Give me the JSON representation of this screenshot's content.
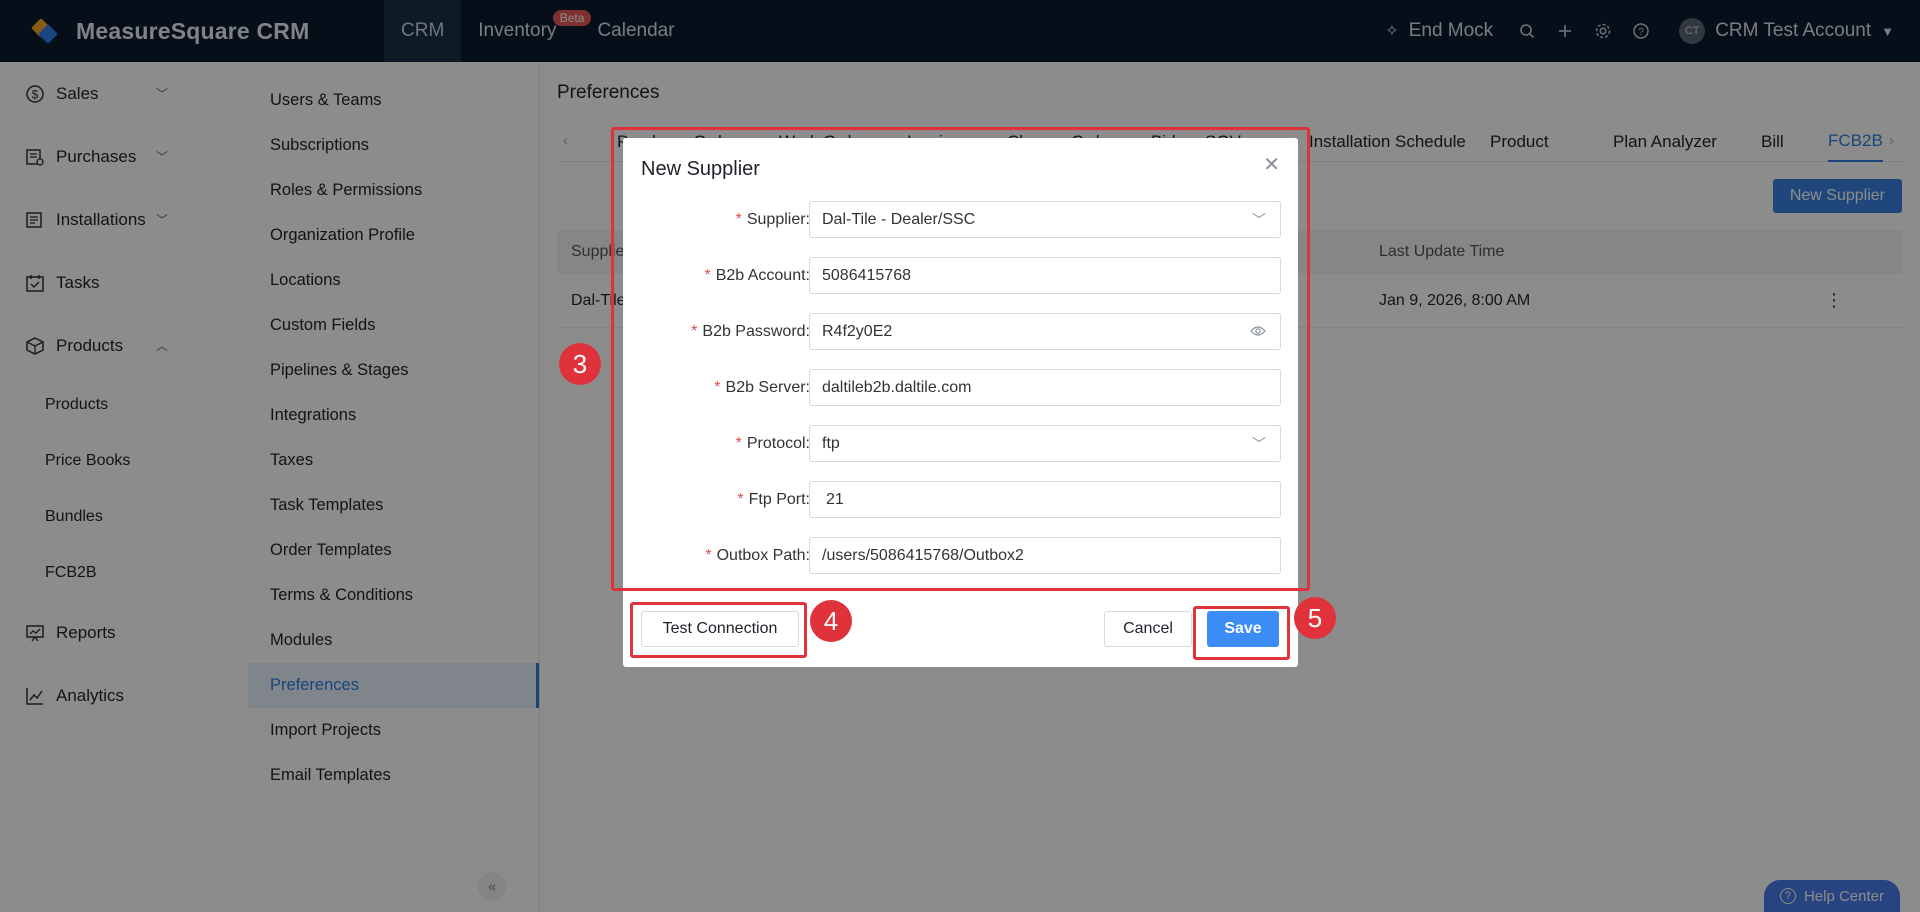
{
  "app": {
    "name": "MeasureSquare CRM"
  },
  "topnav": {
    "items": [
      {
        "label": "CRM"
      },
      {
        "label": "Inventory",
        "badge": "Beta"
      },
      {
        "label": "Calendar"
      }
    ],
    "end_mock": "End Mock",
    "account_initials": "CT",
    "account_name": "CRM Test Account"
  },
  "leftnav": {
    "items": [
      {
        "label": "Sales",
        "icon": "dollar-circle-icon"
      },
      {
        "label": "Purchases",
        "icon": "purchases-icon"
      },
      {
        "label": "Installations",
        "icon": "installations-icon"
      },
      {
        "label": "Tasks",
        "icon": "calendar-check-icon"
      },
      {
        "label": "Products",
        "icon": "box-icon"
      },
      {
        "label": "Reports",
        "icon": "reports-icon"
      },
      {
        "label": "Analytics",
        "icon": "line-chart-icon"
      }
    ],
    "products_sub": [
      "Products",
      "Price Books",
      "Bundles",
      "FCB2B"
    ]
  },
  "settings_menu": {
    "items": [
      "Users & Teams",
      "Subscriptions",
      "Roles & Permissions",
      "Organization Profile",
      "Locations",
      "Custom Fields",
      "Pipelines & Stages",
      "Integrations",
      "Taxes",
      "Task Templates",
      "Order Templates",
      "Terms & Conditions",
      "Modules",
      "Preferences",
      "Import Projects",
      "Email Templates"
    ],
    "active": "Preferences"
  },
  "main": {
    "title": "Preferences",
    "tabs": [
      "Purchase Order",
      "Work Order",
      "Invoice",
      "Change Order",
      "Bid",
      "SOV",
      "Installation Schedule",
      "Product",
      "Plan Analyzer",
      "Bill",
      "FCB2B"
    ],
    "active_tab": "FCB2B",
    "new_supplier_button": "New Supplier",
    "table": {
      "headers": [
        "Supplier",
        "Last Update Time"
      ],
      "rows": [
        {
          "supplier": "Dal-Tile",
          "last_update": "Jan 9, 2026, 8:00 AM"
        }
      ]
    }
  },
  "help_center": "Help Center",
  "modal": {
    "title": "New Supplier",
    "fields": [
      {
        "label": "Supplier:",
        "value": "Dal-Tile - Dealer/SSC",
        "kind": "select"
      },
      {
        "label": "B2b Account:",
        "value": "5086415768",
        "kind": "text"
      },
      {
        "label": "B2b Password:",
        "value": "R4f2y0E2",
        "kind": "password"
      },
      {
        "label": "B2b Server:",
        "value": "daltileb2b.daltile.com",
        "kind": "text"
      },
      {
        "label": "Protocol:",
        "value": "ftp",
        "kind": "select"
      },
      {
        "label": "Ftp Port:",
        "value": "21",
        "kind": "text"
      },
      {
        "label": "Outbox Path:",
        "value": "/users/5086415768/Outbox2",
        "kind": "text"
      }
    ],
    "test_connection": "Test Connection",
    "cancel": "Cancel",
    "save": "Save"
  },
  "annotations": {
    "markers": [
      "3",
      "4",
      "5"
    ],
    "color": "#e0323a"
  }
}
